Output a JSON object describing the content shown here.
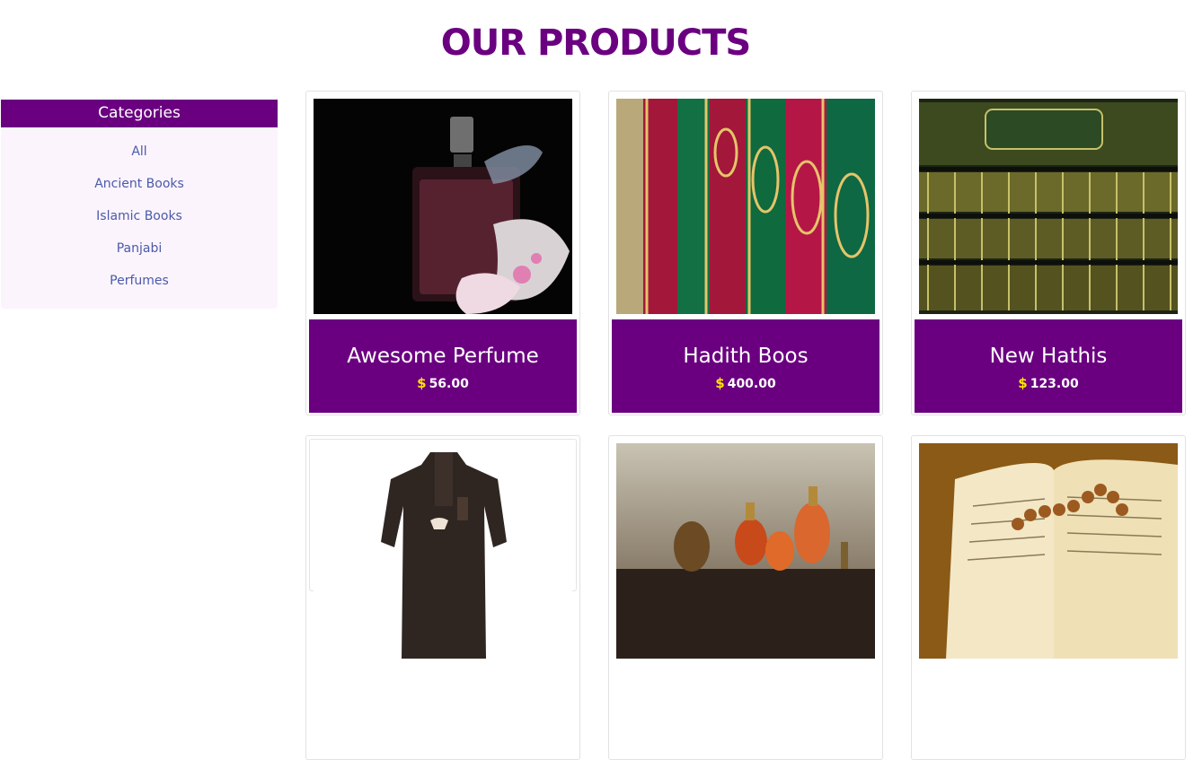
{
  "page": {
    "title": "OUR PRODUCTS"
  },
  "sidebar": {
    "title": "Categories",
    "items": [
      {
        "label": "All"
      },
      {
        "label": "Ancient Books"
      },
      {
        "label": "Islamic Books"
      },
      {
        "label": "Panjabi"
      },
      {
        "label": "Perfumes"
      }
    ]
  },
  "currency_symbol": "$",
  "products": [
    {
      "name": "Awesome Perfume",
      "price": "56.00",
      "image": "perfume-bottle-image"
    },
    {
      "name": "Hadith Boos",
      "price": "400.00",
      "image": "hadith-books-image"
    },
    {
      "name": "New Hathis",
      "price": "123.00",
      "image": "bookshelf-image"
    },
    {
      "image": "panjabi-garment-image"
    },
    {
      "image": "perfume-bottles-image"
    },
    {
      "image": "open-quran-image"
    }
  ],
  "colors": {
    "brand": "#6a0080",
    "price_symbol": "#ffe600",
    "category_link": "#4a5aa8",
    "sidebar_bg": "#fbf4fd"
  }
}
